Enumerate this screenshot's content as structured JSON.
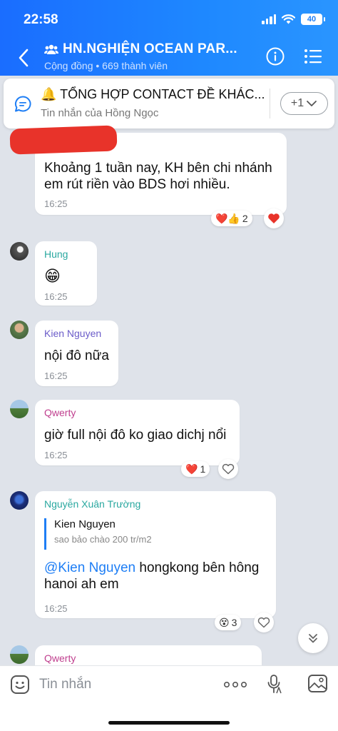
{
  "status": {
    "time": "22:58",
    "battery": "40"
  },
  "header": {
    "title": "HN.NGHIỆN OCEAN PAR...",
    "subtitle": "Cộng đồng • 669 thành viên",
    "color": "#1e7ef5"
  },
  "pinned": {
    "title": "🔔 TỔNG HỢP CONTACT ĐỀ KHÁC...",
    "subtitle": "Tin nhắn của Hồng Ngọc",
    "more_label": "+1"
  },
  "messages": [
    {
      "sender": "",
      "lines": [
        "Khoảng 1 tuần nay, KH bên chi nhánh",
        "em rút riền vào BDS hơi nhiều."
      ],
      "time": "16:25",
      "reactions": {
        "emoji": "❤️👍",
        "count": "2"
      }
    },
    {
      "sender": "Hung",
      "sender_color": "#2aa8a0",
      "lines": [
        "😁"
      ],
      "time": "16:25"
    },
    {
      "sender": "Kien Nguyen",
      "sender_color": "#6b5cc9",
      "lines": [
        "nội đô nữa"
      ],
      "time": "16:25"
    },
    {
      "sender": "Qwerty",
      "sender_color": "#c0408f",
      "lines": [
        "giờ full nội đô ko giao dichj nổi"
      ],
      "time": "16:25",
      "reactions": {
        "emoji": "❤️",
        "count": "1"
      }
    },
    {
      "sender": "Nguyễn Xuân Trường",
      "sender_color": "#2aa8a0",
      "quote": {
        "author": "Kien Nguyen",
        "text": "sao bảo chào 200 tr/m2"
      },
      "mention": "@Kien Nguyen",
      "lines": [
        " hongkong bên hông",
        "hanoi ah em"
      ],
      "time": "16:25",
      "reactions": {
        "emoji": "😵",
        "count": "3"
      }
    },
    {
      "sender": "Qwerty",
      "sender_color": "#c0408f"
    }
  ],
  "input": {
    "placeholder": "Tin nhắn"
  }
}
